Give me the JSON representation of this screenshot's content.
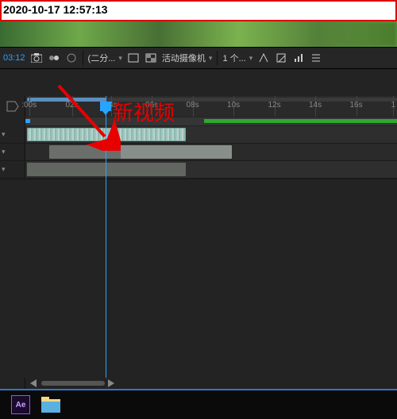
{
  "timestamp": "2020-10-17 12:57:13",
  "toolbar": {
    "timecode": "03:12",
    "preview_quality": "(二分...",
    "camera": "活动摄像机",
    "views": "1 个..."
  },
  "ruler": {
    "ticks": [
      {
        "label": ":00s",
        "pct": 1
      },
      {
        "label": "02s",
        "pct": 12.5
      },
      {
        "label": "04s",
        "pct": 23
      },
      {
        "label": "06s",
        "pct": 34
      },
      {
        "label": "08s",
        "pct": 45
      },
      {
        "label": "10s",
        "pct": 56
      },
      {
        "label": "12s",
        "pct": 67
      },
      {
        "label": "14s",
        "pct": 78
      },
      {
        "label": "16s",
        "pct": 89
      },
      {
        "label": "1",
        "pct": 99
      }
    ]
  },
  "playhead_pct": 21.5,
  "overview_green": {
    "left_pct": 48,
    "width_pct": 52
  },
  "annotation": {
    "text": "新视频"
  },
  "taskbar": {
    "ae": "Ae"
  }
}
